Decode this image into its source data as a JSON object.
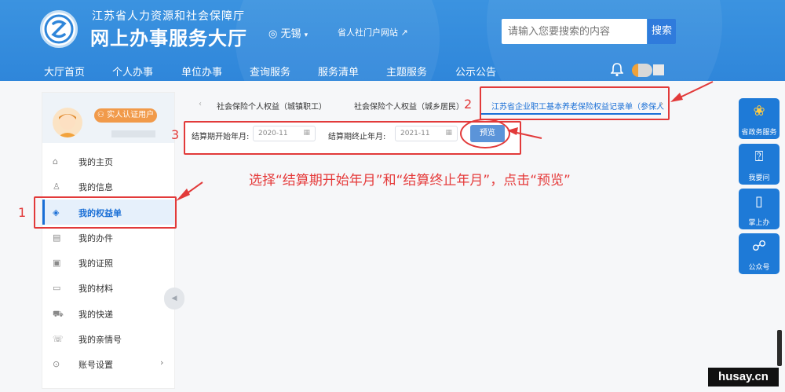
{
  "header": {
    "subtitle": "江苏省人力资源和社会保障厅",
    "title": "网上办事服务大厅",
    "region": "无锡",
    "portal_link": "省人社门户网站",
    "search_placeholder": "请输入您要搜索的内容",
    "search_button": "搜索"
  },
  "nav": [
    "大厅首页",
    "个人办事",
    "单位办事",
    "查询服务",
    "服务清单",
    "主题服务",
    "公示公告"
  ],
  "user": {
    "badge": "实人认证用户"
  },
  "sidebar": {
    "items": [
      {
        "label": "我的主页",
        "icon": "home-icon"
      },
      {
        "label": "我的信息",
        "icon": "user-icon"
      },
      {
        "label": "我的权益单",
        "icon": "shield-icon",
        "active": true
      },
      {
        "label": "我的办件",
        "icon": "file-icon"
      },
      {
        "label": "我的证照",
        "icon": "id-card-icon"
      },
      {
        "label": "我的材料",
        "icon": "folder-icon"
      },
      {
        "label": "我的快递",
        "icon": "truck-icon"
      },
      {
        "label": "我的亲情号",
        "icon": "family-icon"
      },
      {
        "label": "账号设置",
        "icon": "settings-icon"
      }
    ]
  },
  "tabs": [
    {
      "label": "社会保险个人权益（城镇职工）"
    },
    {
      "label": "社会保险个人权益（城乡居民）"
    },
    {
      "label": "江苏省企业职工基本养老保险权益记录单（参保人",
      "active": true
    }
  ],
  "filters": {
    "start_label": "结算期开始年月:",
    "start_value": "2020-11",
    "end_label": "结算期终止年月:",
    "end_value": "2021-11",
    "preview_button": "预览"
  },
  "instruction": "选择“结算期开始年月”和“结算终止年月”，点击“预览”",
  "annotations": [
    "1",
    "2",
    "3"
  ],
  "right_rail": [
    {
      "label": "省政务服务",
      "icon": "gov-service-icon"
    },
    {
      "label": "我要问",
      "icon": "question-icon"
    },
    {
      "label": "掌上办",
      "icon": "mobile-icon"
    },
    {
      "label": "公众号",
      "icon": "wechat-icon"
    }
  ],
  "watermark": "husay.cn",
  "colors": {
    "header": "#3b93e0",
    "accent": "#1a6fd6",
    "annotation": "#e23a3a"
  }
}
